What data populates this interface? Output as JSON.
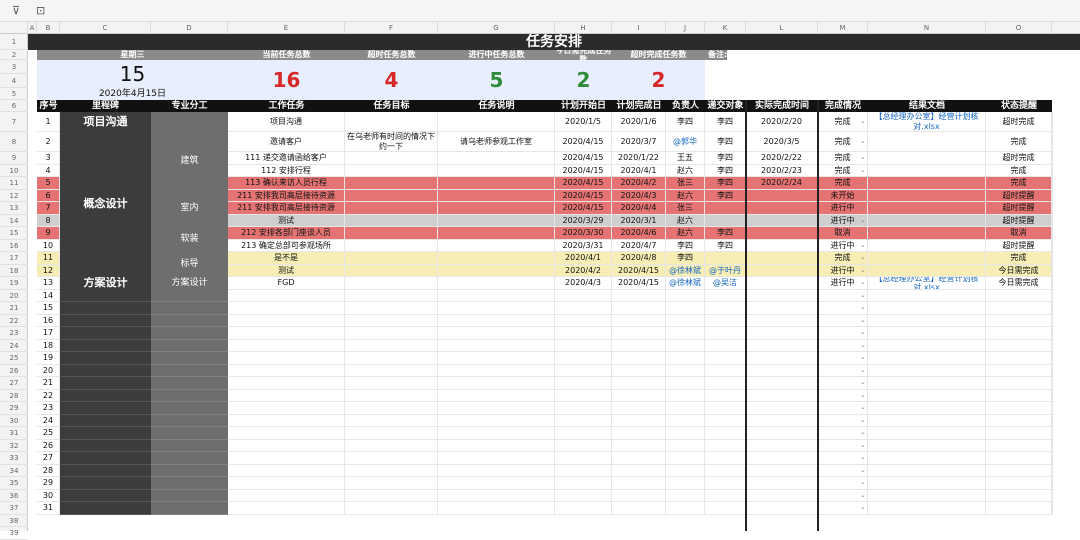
{
  "toolbar": {
    "filter_icon": "filter-icon",
    "freeze_icon": "freeze-icon"
  },
  "columns": [
    "A",
    "B",
    "C",
    "D",
    "E",
    "F",
    "G",
    "H",
    "I",
    "J",
    "K",
    "L",
    "M",
    "N",
    "O"
  ],
  "title": "任务安排",
  "summary": {
    "weekday": "星期三",
    "day": "15",
    "date": "2020年4月15日",
    "current_label": "当前任务总数",
    "current_value": "16",
    "overdue_label": "超时任务总数",
    "overdue_value": "4",
    "progress_label": "进行中任务总数",
    "progress_value": "5",
    "today_label": "今日需完成任务数",
    "today_value": "2",
    "overdue_done_label": "超时完成任务数",
    "overdue_done_value": "2",
    "note_label": "备注:"
  },
  "headers": [
    "序号",
    "里程碑",
    "专业分工",
    "工作任务",
    "任务目标",
    "任务说明",
    "计划开始日",
    "计划完成日",
    "负责人",
    "递交对象",
    "实际完成时间",
    "完成情况",
    "结果文档",
    "状态提醒"
  ],
  "milestones": [
    "项目沟通",
    "概念设计",
    "方案设计"
  ],
  "divisions": [
    "建筑",
    "室内",
    "软装",
    "标导",
    "方案设计"
  ],
  "rows": [
    {
      "no": "1",
      "task": "项目沟通",
      "goal": "",
      "desc": "",
      "start": "2020/1/5",
      "end": "2020/1/6",
      "owner": "李四",
      "to": "李四",
      "actual": "2020/2/20",
      "status": "完成",
      "doc": "【总经理办公室】经营计划核对.xlsx",
      "remind": "超时完成"
    },
    {
      "no": "2",
      "task": "邀请客户",
      "goal": "在乌老师有时间的情况下约一下",
      "desc": "请乌老师参观工作室",
      "start": "2020/4/15",
      "end": "2020/3/7",
      "owner": "@郭华",
      "to": "李四",
      "actual": "2020/3/5",
      "status": "完成",
      "doc": "",
      "remind": "完成"
    },
    {
      "no": "3",
      "task": "111  递交邀请函给客户",
      "goal": "",
      "desc": "",
      "start": "2020/4/15",
      "end": "2020/1/22",
      "owner": "王五",
      "to": "李四",
      "actual": "2020/2/22",
      "status": "完成",
      "doc": "",
      "remind": "超时完成"
    },
    {
      "no": "4",
      "task": "112  安排行程",
      "goal": "",
      "desc": "",
      "start": "2020/4/15",
      "end": "2020/4/1",
      "owner": "赵六",
      "to": "李四",
      "actual": "2020/2/23",
      "status": "完成",
      "doc": "",
      "remind": "完成"
    },
    {
      "no": "5",
      "task": "113  确认来访人员行程",
      "goal": "",
      "desc": "",
      "start": "2020/4/15",
      "end": "2020/4/2",
      "owner": "张三",
      "to": "李四",
      "actual": "2020/2/24",
      "status": "完成",
      "doc": "",
      "remind": "完成"
    },
    {
      "no": "6",
      "task": "211  安排我司高层接待资源",
      "goal": "",
      "desc": "",
      "start": "2020/4/15",
      "end": "2020/4/3",
      "owner": "赵六",
      "to": "李四",
      "actual": "",
      "status": "未开始",
      "doc": "",
      "remind": "超时提醒"
    },
    {
      "no": "7",
      "task": "211  安排我司高层接待资源",
      "goal": "",
      "desc": "",
      "start": "2020/4/15",
      "end": "2020/4/4",
      "owner": "张三",
      "to": "",
      "actual": "",
      "status": "进行中",
      "doc": "",
      "remind": "超时提醒"
    },
    {
      "no": "8",
      "task": "测试",
      "goal": "",
      "desc": "",
      "start": "2020/3/29",
      "end": "2020/3/1",
      "owner": "赵六",
      "to": "",
      "actual": "",
      "status": "进行中",
      "doc": "",
      "remind": "超时提醒"
    },
    {
      "no": "9",
      "task": "212  安排各部门座谈人员",
      "goal": "",
      "desc": "",
      "start": "2020/3/30",
      "end": "2020/4/6",
      "owner": "赵六",
      "to": "李四",
      "actual": "",
      "status": "取消",
      "doc": "",
      "remind": "取消"
    },
    {
      "no": "10",
      "task": "213  确定总部可参观场所",
      "goal": "",
      "desc": "",
      "start": "2020/3/31",
      "end": "2020/4/7",
      "owner": "李四",
      "to": "李四",
      "actual": "",
      "status": "进行中",
      "doc": "",
      "remind": "超时提醒"
    },
    {
      "no": "11",
      "task": "是不是",
      "goal": "",
      "desc": "",
      "start": "2020/4/1",
      "end": "2020/4/8",
      "owner": "李四",
      "to": "",
      "actual": "",
      "status": "完成",
      "doc": "",
      "remind": "完成"
    },
    {
      "no": "12",
      "task": "测试",
      "goal": "",
      "desc": "",
      "start": "2020/4/2",
      "end": "2020/4/15",
      "owner": "@徐林斌",
      "to": "@于叶丹",
      "actual": "",
      "status": "进行中",
      "doc": "",
      "remind": "今日需完成"
    },
    {
      "no": "13",
      "task": "FGD",
      "goal": "",
      "desc": "",
      "start": "2020/4/3",
      "end": "2020/4/15",
      "owner": "@徐林斌",
      "to": "@吴洁",
      "actual": "",
      "status": "进行中",
      "doc": "【总经理办公室】经营计划核对.xlsx",
      "remind": "今日需完成"
    }
  ],
  "empty_numbers": [
    "14",
    "15",
    "16",
    "17",
    "18",
    "19",
    "20",
    "21",
    "22",
    "23",
    "24",
    "25",
    "26",
    "27",
    "28",
    "29",
    "30",
    "31"
  ],
  "colors": {
    "red_row": "#e57373",
    "gray_row": "#cfcfcf",
    "yellow_row": "#f6eeb4",
    "header": "#111111",
    "accent_red": "#d62828",
    "accent_green": "#2e8b3a"
  }
}
